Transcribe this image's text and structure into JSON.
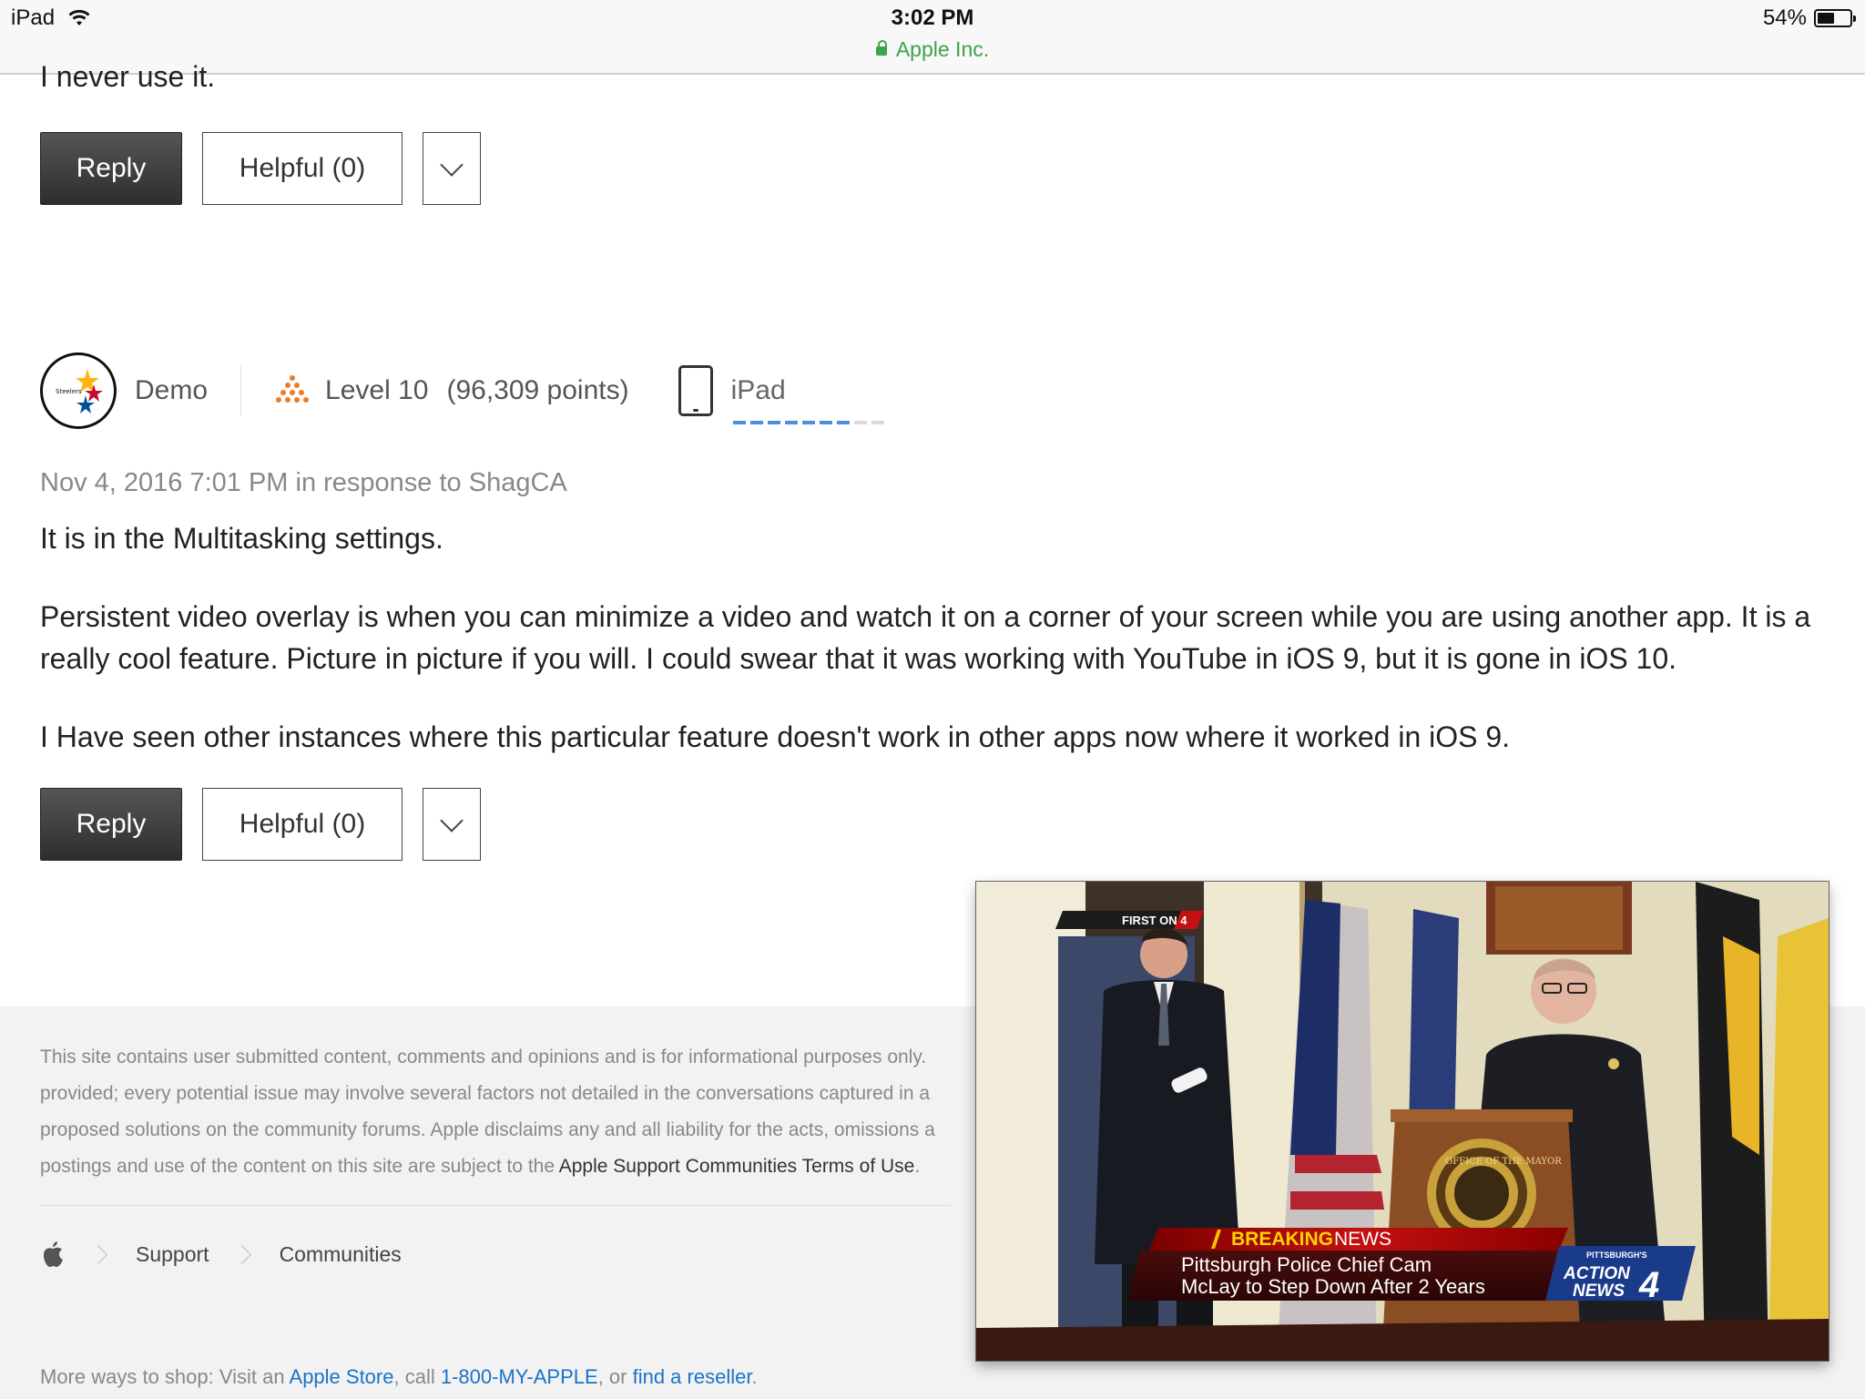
{
  "status_bar": {
    "device": "iPad",
    "time": "3:02 PM",
    "url_label": "Apple Inc.",
    "battery": "54%",
    "battery_level": 0.54
  },
  "post1": {
    "tail_text": "I never use it.",
    "reply": "Reply",
    "helpful": "Helpful (0)"
  },
  "post2": {
    "author": "Demo",
    "level": "Level 10",
    "points": "(96,309 points)",
    "device": "iPad",
    "meta": "Nov 4, 2016 7:01 PM in response to ShagCA",
    "paragraphs": [
      "It is in the Multitasking settings.",
      "Persistent video overlay is when you can minimize a video and watch it on a corner of your screen while you are using another app. It is a really cool feature. Picture in picture if you will. I could swear that it was working with YouTube in iOS 9, but it is gone in iOS 10.",
      "I Have seen other instances where this particular feature doesn't work in other apps now where it worked in iOS 9."
    ],
    "reply": "Reply",
    "helpful": "Helpful (0)"
  },
  "footer": {
    "disclaimer_lines": [
      "This site contains user submitted content, comments and opinions and is for informational purposes only.",
      "provided; every potential issue may involve several factors not detailed in the conversations captured in a",
      "proposed solutions on the community forums. Apple disclaims any and all liability for the acts, omissions a",
      "postings and use of the content on this site are subject to the "
    ],
    "terms_link": "Apple Support Communities Terms of Use",
    "terms_suffix": ".",
    "breadcrumbs": [
      "Support",
      "Communities"
    ],
    "shop_prefix": "More ways to shop: Visit an ",
    "apple_store": "Apple Store",
    "shop_mid1": ", call ",
    "phone": "1-800-MY-APPLE",
    "shop_mid2": ", or ",
    "reseller": "find a reseller",
    "shop_end": "."
  },
  "video": {
    "first_on": "FIRST ON 4",
    "breaking_a": "BREAKING",
    "breaking_b": "NEWS",
    "headline1": "Pittsburgh Police Chief Cam",
    "headline2": "McLay to Step Down After 2 Years",
    "station_top": "PITTSBURGH'S",
    "station1": "ACTION",
    "station2": "NEWS",
    "station_num": "4",
    "seal": "OFFICE OF THE MAYOR"
  }
}
